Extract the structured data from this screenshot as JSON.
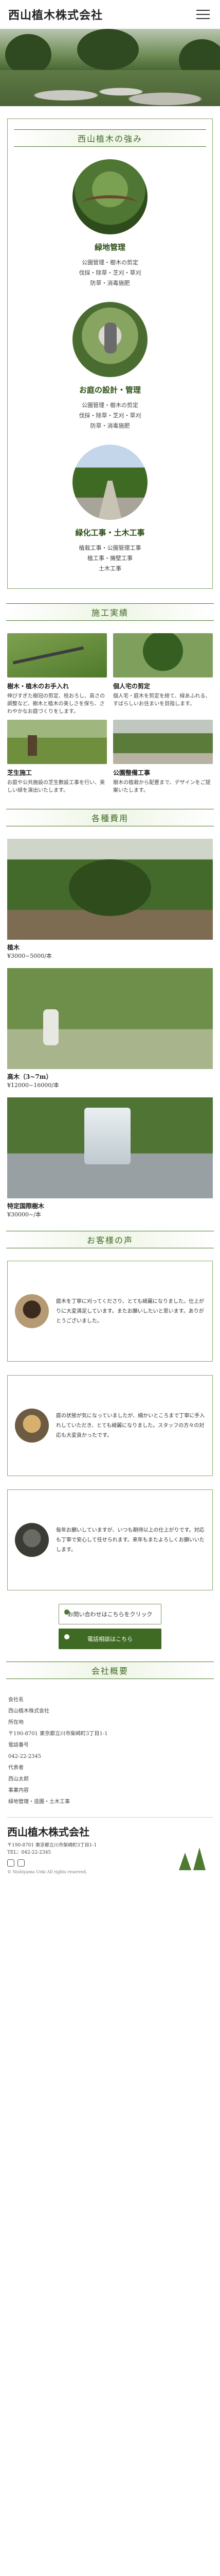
{
  "header": {
    "logo": "西山植木株式会社"
  },
  "strengths": {
    "title": "西山植木の強み",
    "items": [
      {
        "title": "緑地管理",
        "lines": [
          "公園管理・樹木の剪定",
          "伐採・除草・芝刈・草刈",
          "防草・消毒施肥"
        ]
      },
      {
        "title": "お庭の設計・管理",
        "lines": [
          "公園管理・樹木の剪定",
          "伐採・除草・芝刈・草刈",
          "防草・消毒施肥"
        ]
      },
      {
        "title": "緑化工事・土木工事",
        "lines": [
          "植栽工事・公園管理工事",
          "植工事・擁壁工事",
          "土木工事"
        ]
      }
    ]
  },
  "works": {
    "title": "施工実績",
    "items": [
      {
        "title": "樹木・植木のお手入れ",
        "text": "伸びすぎた樹冠の剪定、枝おろし、高さの調整など、樹木と植木の美しさを保ち、さわやかなお庭づくりをします。"
      },
      {
        "title": "個人宅の剪定",
        "text": "個人宅・庭木を剪定を経て、緑あふれる、すばらしいお住まいを目指します。"
      },
      {
        "title": "芝生施工",
        "text": "お庭や公共施設の芝生敷設工事を行い、美しい緑を演出いたします。"
      },
      {
        "title": "公園整備工事",
        "text": "樹木の植栽から配置まで、デザインをご提案いたします。"
      }
    ]
  },
  "prices": {
    "title": "各種費用",
    "items": [
      {
        "title": "植木",
        "price": "¥3000~5000/本"
      },
      {
        "title": "高木（3~7m）",
        "price": "¥12000~16000/本"
      },
      {
        "title": "特定国際樹木",
        "price": "¥30000~/本"
      }
    ]
  },
  "voices": {
    "title": "お客様の声",
    "items": [
      {
        "text": "庭木を丁寧に刈ってくださり、とても綺麗になりました。仕上がりに大変満足しています。またお願いしたいと思います。ありがとうございました。"
      },
      {
        "text": "庭の状態が気になっていましたが、細かいところまで丁寧に手入れしていただき、とても綺麗になりました。スタッフの方々の対応も大変良かったです。"
      },
      {
        "text": "毎年お願いしていますが、いつも期待以上の仕上がりです。対応も丁寧で安心して任せられます。来年もまたよろしくお願いいたします。"
      }
    ]
  },
  "cta": {
    "contact": "お問い合わせはこちらをクリック",
    "phone": "電話相談はこちら"
  },
  "company": {
    "title": "会社概要",
    "rows": [
      "会社名",
      "西山植木株式会社",
      "所在地",
      "〒190-8701 東京都立川市柴崎町3丁目1-1",
      "電話番号",
      "042-22-2345",
      "代表者",
      "西山太郎",
      "事業内容",
      "緑地管理・造園・土木工事"
    ]
  },
  "footer": {
    "logo": "西山植木株式会社",
    "address": "〒190-8701 東京都立川市柴崎町3丁目1-1",
    "tel": "TEL：042-22-2345",
    "copyright": "© Nishiyama Ueki All rights reserved."
  },
  "colors": {
    "accent": "#3f6a23",
    "border": "#8aa56b"
  }
}
